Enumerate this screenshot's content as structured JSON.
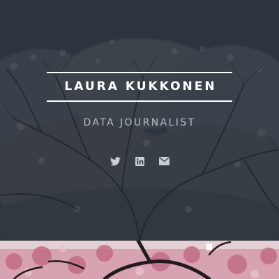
{
  "header": {
    "site_title": "LAURA KUKKONEN",
    "tagline": "DATA JOURNALIST"
  },
  "social_links": [
    {
      "icon": "twitter-icon"
    },
    {
      "icon": "linkedin-icon"
    },
    {
      "icon": "envelope-icon"
    }
  ],
  "colors": {
    "title_text": "#ffffff",
    "tagline_text": "#b9bec4",
    "social_icon": "#c9ced3",
    "hero_overlay": "#343c46",
    "blossom_pink": "#d08a9c"
  }
}
